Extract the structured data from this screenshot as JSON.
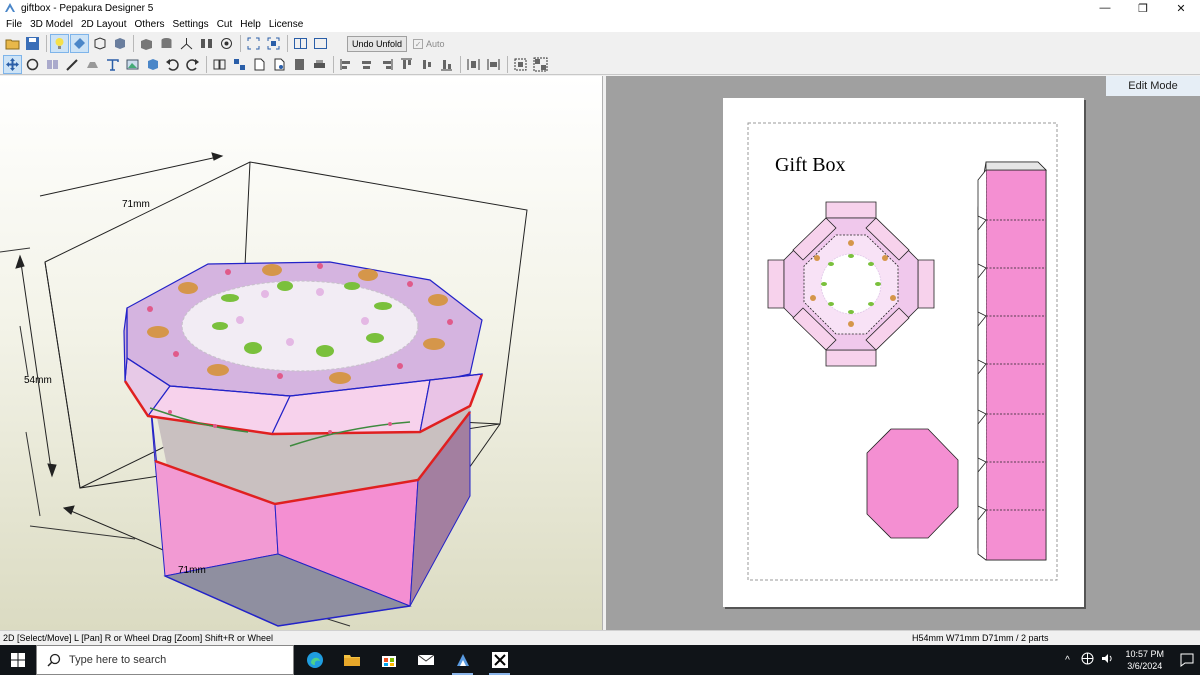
{
  "window": {
    "title": "giftbox - Pepakura Designer 5",
    "minimize": "—",
    "maximize": "❐",
    "close": "✕"
  },
  "menu": [
    "File",
    "3D Model",
    "2D Layout",
    "Others",
    "Settings",
    "Cut",
    "Help",
    "License"
  ],
  "toolbar": {
    "undo_unfold": "Undo Unfold",
    "auto": "Auto",
    "auto_check": "✓"
  },
  "view3d": {
    "dim_top": "71mm",
    "dim_left": "54mm",
    "dim_bottom": "71mm"
  },
  "view2d": {
    "edit_mode": "Edit Mode",
    "sheet_title": "Gift Box"
  },
  "status": {
    "left": "2D [Select/Move] L [Pan] R or Wheel Drag [Zoom] Shift+R or Wheel",
    "right": "H54mm W71mm D71mm / 2 parts"
  },
  "taskbar": {
    "search_placeholder": "Type here to search",
    "time": "10:57 PM",
    "date": "3/6/2024",
    "tray_chevron": "^"
  },
  "colors": {
    "pink": "#f48fd2",
    "lilac": "#dcb8e4",
    "outline": "#2323c8",
    "cut_red": "#e02020",
    "taskbar": "#101418"
  }
}
